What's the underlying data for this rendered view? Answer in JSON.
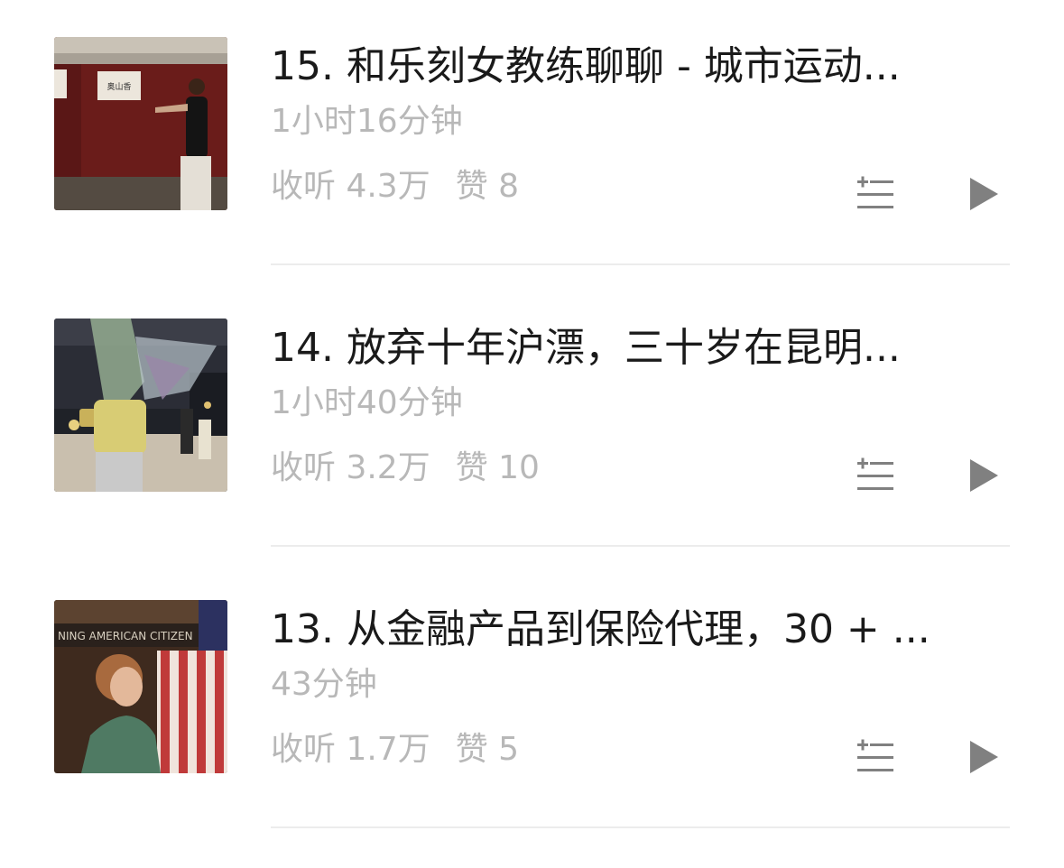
{
  "episodes": [
    {
      "title": "15. 和乐刻女教练聊聊 - 城市运动...",
      "duration": "1小时16分钟",
      "plays": "收听 4.3万",
      "likes": "赞 8",
      "thumbnail_icon": "thumbnail-woman-at-red-wall",
      "sign_text": "奥山香"
    },
    {
      "title": "14. 放弃十年沪漂，三十岁在昆明...",
      "duration": "1小时40分钟",
      "plays": "收听 3.2万",
      "likes": "赞 10",
      "thumbnail_icon": "thumbnail-woman-holding-flowers"
    },
    {
      "title": "13. 从金融产品到保险代理，30 + ...",
      "duration": "43分钟",
      "plays": "收听 1.7万",
      "likes": "赞 5",
      "thumbnail_icon": "thumbnail-woman-with-flag",
      "sign_text": "NING AMERICAN CITIZEN"
    }
  ],
  "icons": {
    "queue": "add-to-playlist-icon",
    "play": "play-icon"
  },
  "colors": {
    "title": "#1a1a1a",
    "meta": "#b8b8b8",
    "icon": "#808080",
    "divider": "#ececec"
  }
}
